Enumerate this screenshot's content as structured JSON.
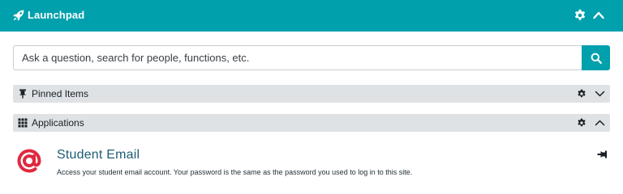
{
  "header": {
    "title": "Launchpad",
    "icons": {
      "left": "rocket-icon",
      "settings": "gear-icon",
      "collapse": "chevron-up-icon"
    },
    "background": "#00a0ad"
  },
  "search": {
    "placeholder": "Ask a question, search for people, functions, etc.",
    "value": "",
    "button_icon": "search-icon"
  },
  "sections": {
    "pinned": {
      "label": "Pinned Items",
      "icon": "thumbtack-icon",
      "expanded": false
    },
    "applications": {
      "label": "Applications",
      "icon": "grid-icon",
      "expanded": true
    }
  },
  "applications": {
    "items": [
      {
        "title": "Student Email",
        "description": "Access your student email account. Your password is the same as the password you used to log in to this site.",
        "icon": "at-sign-icon",
        "icon_color": "#e0293f",
        "action_icon": "pin-icon"
      }
    ]
  },
  "colors": {
    "accent": "#00a0ad",
    "section_bg": "#dee2e5",
    "link": "#1e5b72"
  }
}
